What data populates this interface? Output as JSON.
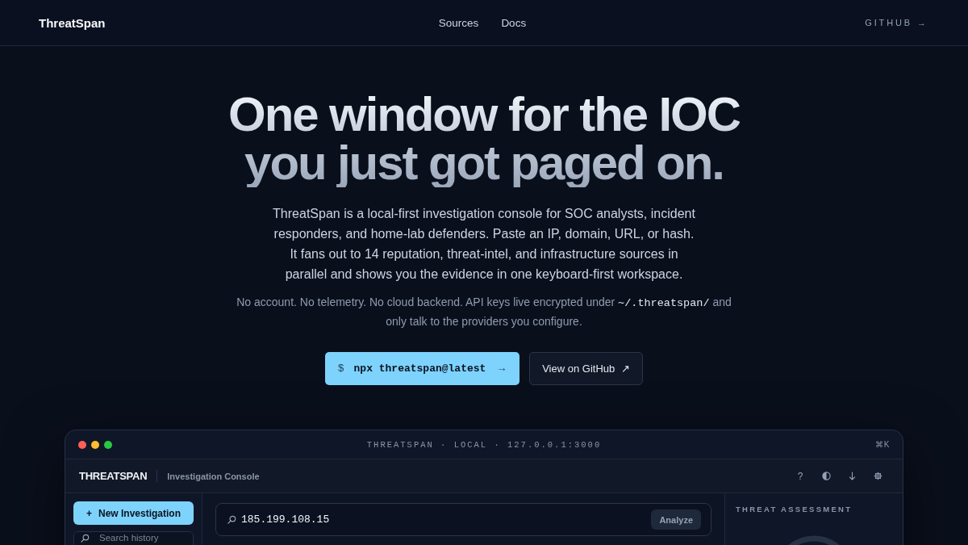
{
  "nav": {
    "brand": "ThreatSpan",
    "links": [
      "Sources",
      "Docs"
    ],
    "github": {
      "label": "GITHUB",
      "arrow": "→"
    }
  },
  "hero": {
    "title_lines": [
      "One window for the IOC",
      "you just got paged on."
    ],
    "description": "ThreatSpan is a local-first investigation console for SOC analysts, incident responders, and home-lab defenders. Paste an IP, domain, URL, or hash. It fans out to 14 reputation, threat-intel, and infrastructure sources in parallel and shows you the evidence in one keyboard-first workspace.",
    "note": {
      "before": "No account. No telemetry. No cloud backend. API keys live encrypted under",
      "code": "~/.threatspan/",
      "after": "and only talk to the providers you configure."
    },
    "actions": [
      {
        "kind": "primary",
        "prompt": "$",
        "label": "npx threatspan@latest",
        "arrow": "→"
      },
      {
        "kind": "secondary",
        "label": "View on GitHub",
        "arrow": "↗"
      }
    ]
  },
  "app_window": {
    "title": "THREATSPAN · LOCAL · 127.0.0.1:3000",
    "shortcut": "⌘K",
    "brand": "THREATSPAN",
    "subtitle": "Investigation Console",
    "toolbar_actions": [
      {
        "kind": "help",
        "label": "?"
      },
      {
        "kind": "contrast"
      },
      {
        "kind": "download"
      },
      {
        "kind": "settings"
      }
    ],
    "sidebar": {
      "new_button": {
        "icon": "+",
        "label": "New Investigation"
      },
      "search": {
        "placeholder": "Search history"
      }
    },
    "query": {
      "value": "185.199.108.15",
      "button": "Analyze"
    },
    "assessment": {
      "title": "THREAT ASSESSMENT"
    }
  }
}
